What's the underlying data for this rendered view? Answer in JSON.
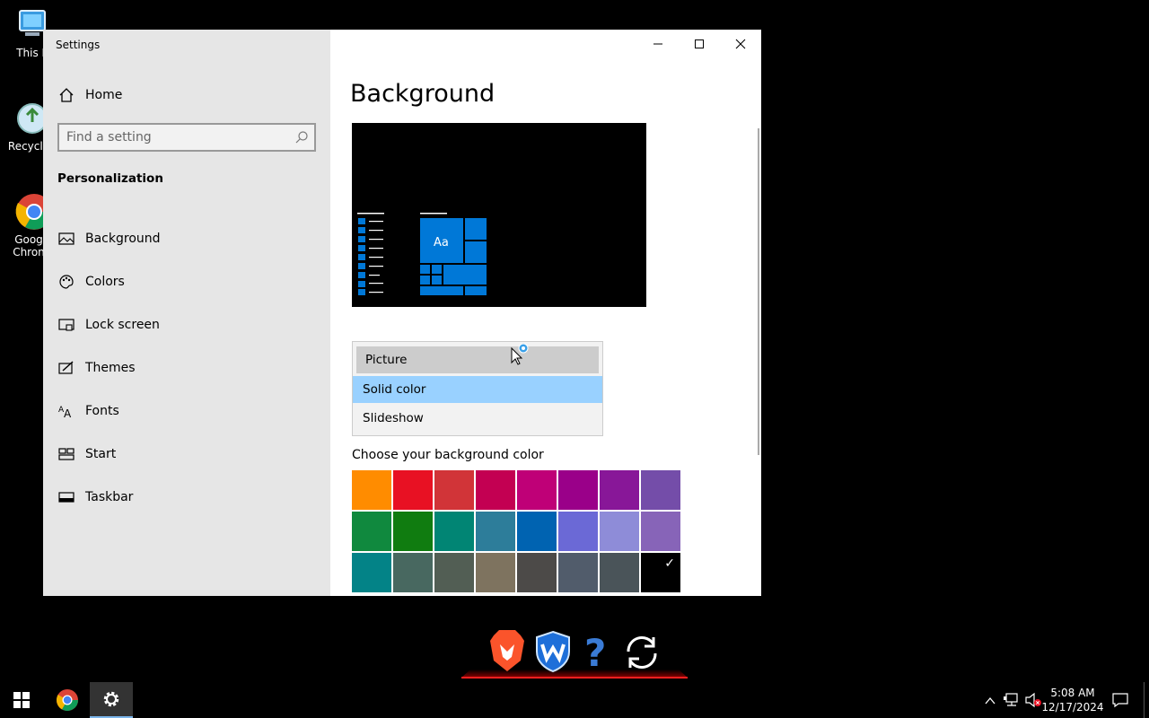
{
  "desktop": {
    "icons": [
      {
        "name": "this-pc",
        "label": "This P"
      },
      {
        "name": "recycle-bin",
        "label": "Recycle"
      },
      {
        "name": "google-chrome",
        "label": "Goog\nChron"
      }
    ]
  },
  "window": {
    "title": "Settings",
    "controls": {
      "minimize": "minimize-icon",
      "maximize": "maximize-icon",
      "close": "close-icon"
    }
  },
  "sidebar": {
    "home_label": "Home",
    "search_placeholder": "Find a setting",
    "section_title": "Personalization",
    "items": [
      {
        "label": "Background",
        "icon": "picture-icon"
      },
      {
        "label": "Colors",
        "icon": "palette-icon"
      },
      {
        "label": "Lock screen",
        "icon": "lock-screen-icon"
      },
      {
        "label": "Themes",
        "icon": "themes-icon"
      },
      {
        "label": "Fonts",
        "icon": "fonts-icon"
      },
      {
        "label": "Start",
        "icon": "start-icon"
      },
      {
        "label": "Taskbar",
        "icon": "taskbar-icon"
      }
    ]
  },
  "main": {
    "page_title": "Background",
    "preview_tile_text": "Aa",
    "dropdown": {
      "options": [
        "Picture",
        "Solid color",
        "Slideshow"
      ],
      "selected": "Picture",
      "hovered": "Solid color"
    },
    "color_caption": "Choose your background color",
    "swatches": [
      "#ff8c00",
      "#e81123",
      "#d13438",
      "#c30052",
      "#bf0077",
      "#9a0089",
      "#881798",
      "#744da9",
      "#10893e",
      "#107c10",
      "#018574",
      "#2d7d9a",
      "#0063b1",
      "#6b69d6",
      "#8e8cd8",
      "#8764b8",
      "#038387",
      "#486860",
      "#525e54",
      "#7e735f",
      "#4c4a48",
      "#515c6b",
      "#4a5459",
      "#000000"
    ],
    "selected_swatch": 23
  },
  "floating_toolbar": {
    "icons": [
      "brave-icon",
      "shield-w-icon",
      "help-icon",
      "refresh-icon"
    ]
  },
  "taskbar": {
    "pinned": [
      "start-icon",
      "chrome-icon",
      "settings-icon"
    ],
    "tray": [
      "chevron-up-icon",
      "network-icon",
      "volume-muted-icon"
    ],
    "time": "5:08 AM",
    "date": "12/17/2024",
    "notification": "action-center-icon"
  }
}
